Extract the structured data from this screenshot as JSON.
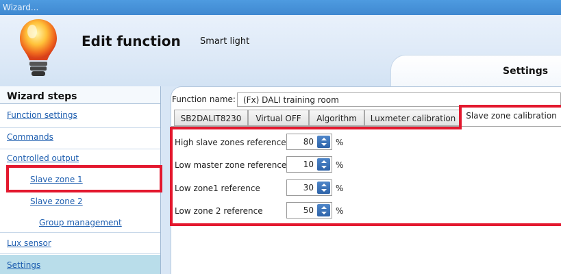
{
  "window": {
    "title": "Wizard..."
  },
  "header": {
    "title": "Edit function",
    "subtitle": "Smart light",
    "tab_label": "Settings"
  },
  "sidebar": {
    "heading": "Wizard steps",
    "items": [
      {
        "label": "Function settings"
      },
      {
        "label": "Commands"
      },
      {
        "label": "Controlled output"
      },
      {
        "label": "Slave zone 1"
      },
      {
        "label": "Slave zone 2"
      },
      {
        "label": "Group management"
      },
      {
        "label": "Lux sensor"
      },
      {
        "label": "Settings"
      }
    ]
  },
  "function_name": {
    "label": "Function name:",
    "value": "(Fx) DALI training room"
  },
  "tabs": [
    {
      "label": "SB2DALIT8230"
    },
    {
      "label": "Virtual OFF"
    },
    {
      "label": "Algorithm"
    },
    {
      "label": "Luxmeter calibration"
    },
    {
      "label": "Slave zone calibration"
    }
  ],
  "params": [
    {
      "label": "High slave zones reference",
      "value": "80",
      "unit": "%"
    },
    {
      "label": "Low master zone reference",
      "value": "10",
      "unit": "%"
    },
    {
      "label": "Low zone1 reference",
      "value": "30",
      "unit": "%"
    },
    {
      "label": "Low zone 2 reference",
      "value": "50",
      "unit": "%"
    }
  ],
  "colors": {
    "accent": "#3f88d0",
    "highlight": "#e3182e",
    "link": "#1f5fb0",
    "active_nav": "#b9ddea"
  }
}
